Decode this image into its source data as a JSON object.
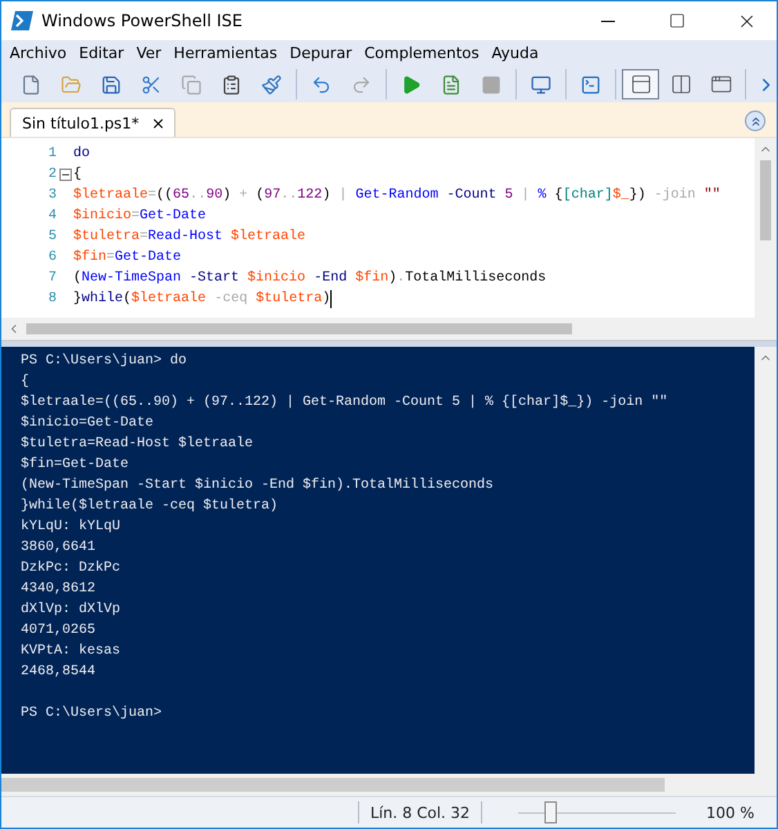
{
  "window": {
    "title": "Windows PowerShell ISE"
  },
  "menu": [
    "Archivo",
    "Editar",
    "Ver",
    "Herramientas",
    "Depurar",
    "Complementos",
    "Ayuda"
  ],
  "toolbar": [
    [
      {
        "kind": "new",
        "disabled": false
      },
      {
        "kind": "open",
        "disabled": false
      },
      {
        "kind": "save",
        "disabled": false
      },
      {
        "kind": "cut",
        "disabled": false
      },
      {
        "kind": "copy",
        "disabled": true
      },
      {
        "kind": "paste",
        "disabled": false
      },
      {
        "kind": "clear",
        "disabled": false
      }
    ],
    [
      {
        "kind": "undo",
        "disabled": false
      },
      {
        "kind": "redo",
        "disabled": true
      }
    ],
    [
      {
        "kind": "run",
        "disabled": false
      },
      {
        "kind": "run-selection",
        "disabled": false
      },
      {
        "kind": "stop",
        "disabled": true
      }
    ],
    [
      {
        "kind": "remote",
        "disabled": false
      }
    ],
    [
      {
        "kind": "console",
        "disabled": false
      }
    ]
  ],
  "layouts": [
    {
      "kind": "top",
      "selected": true
    },
    {
      "kind": "right",
      "selected": false
    },
    {
      "kind": "max",
      "selected": false
    }
  ],
  "tabs": [
    {
      "label": "Sin título1.ps1*",
      "selected": true
    }
  ],
  "editor": {
    "lines": [
      {
        "number": "1",
        "tokens": [
          {
            "kind": "keyword",
            "text": "do"
          }
        ]
      },
      {
        "number": "2",
        "fold": true,
        "tokens": [
          {
            "kind": "brace",
            "text": "{"
          }
        ]
      },
      {
        "number": "3",
        "tokens": [
          {
            "kind": "variable",
            "text": "$letraale"
          },
          {
            "kind": "operator",
            "text": "="
          },
          {
            "kind": "paren",
            "text": "(("
          },
          {
            "kind": "number",
            "text": "65"
          },
          {
            "kind": "operator",
            "text": ".."
          },
          {
            "kind": "number",
            "text": "90"
          },
          {
            "kind": "paren",
            "text": ")"
          },
          {
            "kind": "operator",
            "text": " + "
          },
          {
            "kind": "paren",
            "text": "("
          },
          {
            "kind": "number",
            "text": "97"
          },
          {
            "kind": "operator",
            "text": ".."
          },
          {
            "kind": "number",
            "text": "122"
          },
          {
            "kind": "paren",
            "text": ")"
          },
          {
            "kind": "operator",
            "text": " | "
          },
          {
            "kind": "command",
            "text": "Get-Random"
          },
          {
            "kind": "parameter",
            "text": " -Count"
          },
          {
            "kind": "number",
            "text": " 5"
          },
          {
            "kind": "operator",
            "text": " | "
          },
          {
            "kind": "command",
            "text": "%"
          },
          {
            "kind": "brace",
            "text": " {"
          },
          {
            "kind": "type",
            "text": "[char]"
          },
          {
            "kind": "variable",
            "text": "$_"
          },
          {
            "kind": "brace",
            "text": "}"
          },
          {
            "kind": "paren",
            "text": ")"
          },
          {
            "kind": "operator",
            "text": " -join"
          },
          {
            "kind": "string",
            "text": " \"\""
          }
        ]
      },
      {
        "number": "4",
        "tokens": [
          {
            "kind": "variable",
            "text": "$inicio"
          },
          {
            "kind": "operator",
            "text": "="
          },
          {
            "kind": "command",
            "text": "Get-Date"
          }
        ]
      },
      {
        "number": "5",
        "tokens": [
          {
            "kind": "variable",
            "text": "$tuletra"
          },
          {
            "kind": "operator",
            "text": "="
          },
          {
            "kind": "command",
            "text": "Read-Host"
          },
          {
            "kind": "variable",
            "text": " $letraale"
          }
        ]
      },
      {
        "number": "6",
        "tokens": [
          {
            "kind": "variable",
            "text": "$fin"
          },
          {
            "kind": "operator",
            "text": "="
          },
          {
            "kind": "command",
            "text": "Get-Date"
          }
        ]
      },
      {
        "number": "7",
        "tokens": [
          {
            "kind": "paren",
            "text": "("
          },
          {
            "kind": "command",
            "text": "New-TimeSpan"
          },
          {
            "kind": "parameter",
            "text": " -Start"
          },
          {
            "kind": "variable",
            "text": " $inicio"
          },
          {
            "kind": "parameter",
            "text": " -End"
          },
          {
            "kind": "variable",
            "text": " $fin"
          },
          {
            "kind": "paren",
            "text": ")"
          },
          {
            "kind": "operator",
            "text": "."
          },
          {
            "kind": "member",
            "text": "TotalMilliseconds"
          }
        ]
      },
      {
        "number": "8",
        "cursor": true,
        "tokens": [
          {
            "kind": "brace",
            "text": "}"
          },
          {
            "kind": "keyword",
            "text": "while"
          },
          {
            "kind": "paren",
            "text": "("
          },
          {
            "kind": "variable",
            "text": "$letraale"
          },
          {
            "kind": "operator",
            "text": " -ceq"
          },
          {
            "kind": "variable",
            "text": " $tuletra"
          },
          {
            "kind": "paren",
            "text": ")"
          }
        ]
      }
    ]
  },
  "console": {
    "lines": [
      "PS C:\\Users\\juan> do",
      "{",
      "$letraale=((65..90) + (97..122) | Get-Random -Count 5 | % {[char]$_}) -join \"\"",
      "$inicio=Get-Date",
      "$tuletra=Read-Host $letraale",
      "$fin=Get-Date",
      "(New-TimeSpan -Start $inicio -End $fin).TotalMilliseconds",
      "}while($letraale -ceq $tuletra)",
      "kYLqU: kYLqU",
      "3860,6641",
      "DzkPc: DzkPc",
      "4340,8612",
      "dXlVp: dXlVp",
      "4071,0265",
      "KVPtA: kesas",
      "2468,8544"
    ],
    "prompt": "PS C:\\Users\\juan>"
  },
  "status_bar": {
    "position": "Lín. 8 Col. 32",
    "zoom": {
      "level": 0.21,
      "reading": "100 %"
    }
  }
}
